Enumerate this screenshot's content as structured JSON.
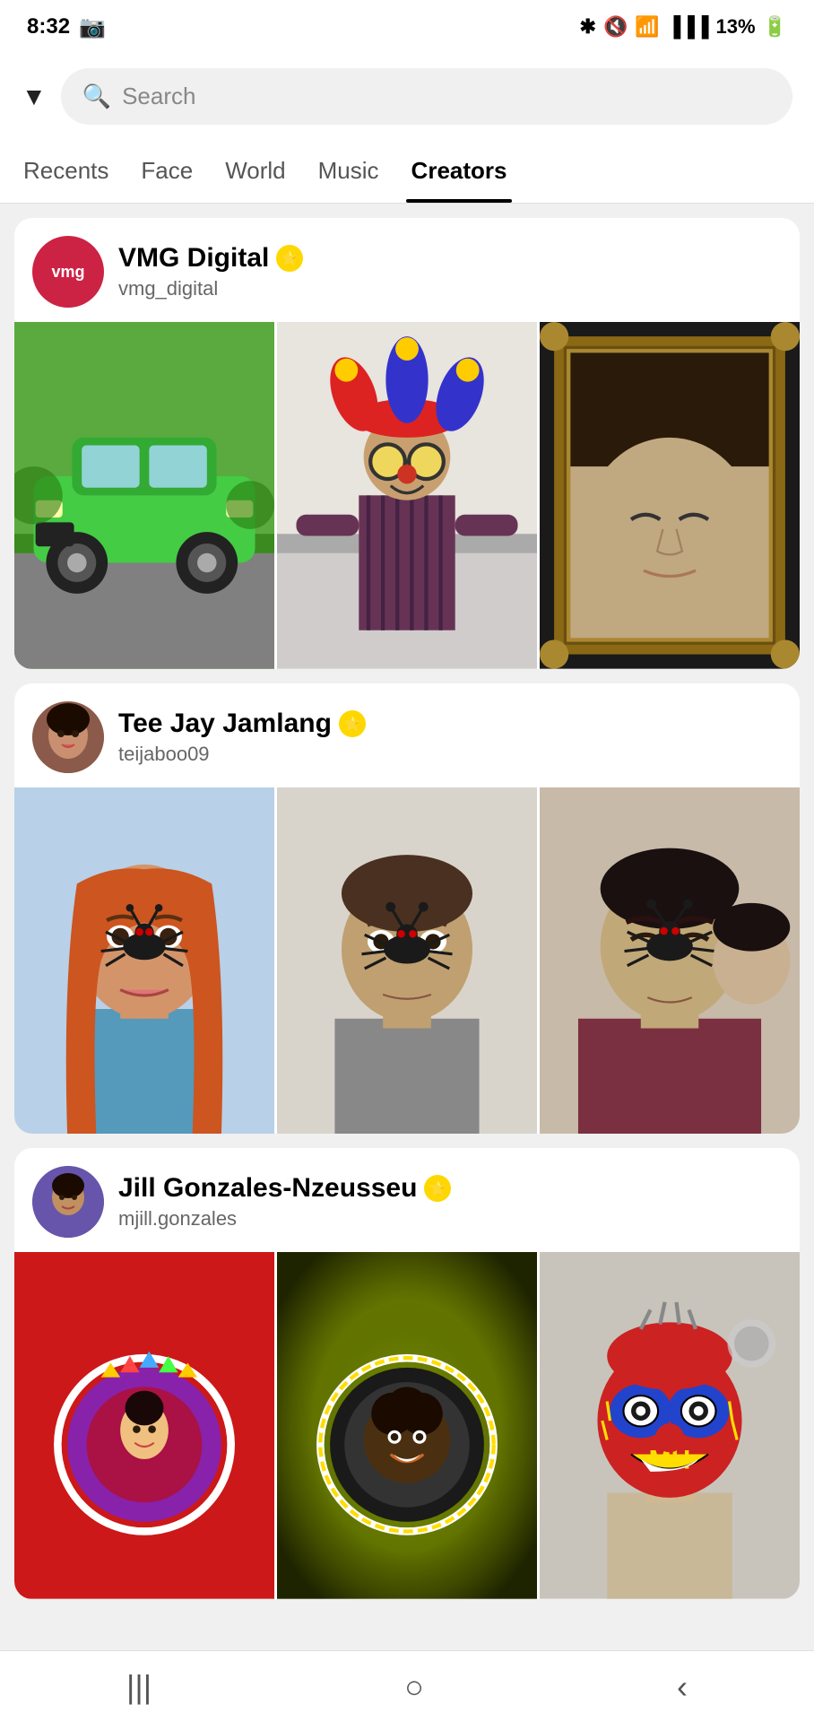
{
  "statusBar": {
    "time": "8:32",
    "battery": "13%",
    "signal": "●●●"
  },
  "search": {
    "placeholder": "Search",
    "dropdownLabel": "▼"
  },
  "tabs": [
    {
      "id": "recents",
      "label": "Recents",
      "active": false
    },
    {
      "id": "face",
      "label": "Face",
      "active": false
    },
    {
      "id": "world",
      "label": "World",
      "active": false
    },
    {
      "id": "music",
      "label": "Music",
      "active": false
    },
    {
      "id": "creators",
      "label": "Creators",
      "active": true
    }
  ],
  "creators": [
    {
      "id": "vmg-digital",
      "name": "VMG Digital",
      "handle": "vmg_digital",
      "verified": true,
      "avatarText": "vmg",
      "avatarColor": "#cc2244"
    },
    {
      "id": "tee-jay",
      "name": "Tee Jay Jamlang",
      "handle": "teijaboo09",
      "verified": true,
      "avatarColor": "#8b5a4a"
    },
    {
      "id": "jill-gonzales",
      "name": "Jill Gonzales-Nzeusseu",
      "handle": "mjill.gonzales",
      "verified": true,
      "avatarColor": "#6655aa"
    }
  ],
  "bottomNav": {
    "icons": [
      "|||",
      "○",
      "<"
    ]
  }
}
